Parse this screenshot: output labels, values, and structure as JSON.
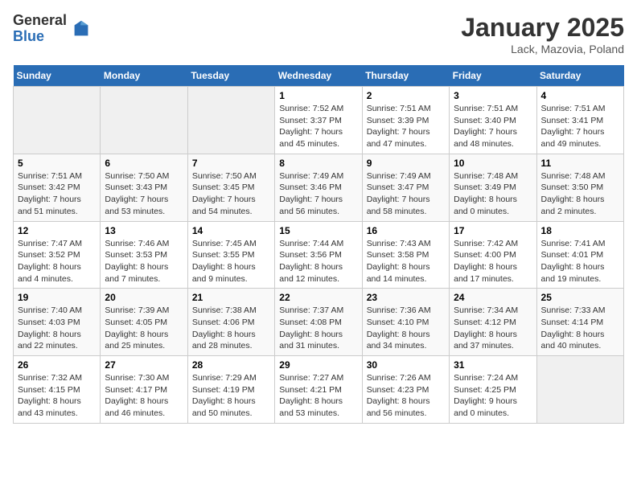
{
  "logo": {
    "general": "General",
    "blue": "Blue"
  },
  "title": "January 2025",
  "location": "Lack, Mazovia, Poland",
  "days_of_week": [
    "Sunday",
    "Monday",
    "Tuesday",
    "Wednesday",
    "Thursday",
    "Friday",
    "Saturday"
  ],
  "weeks": [
    [
      {
        "day": "",
        "info": ""
      },
      {
        "day": "",
        "info": ""
      },
      {
        "day": "",
        "info": ""
      },
      {
        "day": "1",
        "info": "Sunrise: 7:52 AM\nSunset: 3:37 PM\nDaylight: 7 hours and 45 minutes."
      },
      {
        "day": "2",
        "info": "Sunrise: 7:51 AM\nSunset: 3:39 PM\nDaylight: 7 hours and 47 minutes."
      },
      {
        "day": "3",
        "info": "Sunrise: 7:51 AM\nSunset: 3:40 PM\nDaylight: 7 hours and 48 minutes."
      },
      {
        "day": "4",
        "info": "Sunrise: 7:51 AM\nSunset: 3:41 PM\nDaylight: 7 hours and 49 minutes."
      }
    ],
    [
      {
        "day": "5",
        "info": "Sunrise: 7:51 AM\nSunset: 3:42 PM\nDaylight: 7 hours and 51 minutes."
      },
      {
        "day": "6",
        "info": "Sunrise: 7:50 AM\nSunset: 3:43 PM\nDaylight: 7 hours and 53 minutes."
      },
      {
        "day": "7",
        "info": "Sunrise: 7:50 AM\nSunset: 3:45 PM\nDaylight: 7 hours and 54 minutes."
      },
      {
        "day": "8",
        "info": "Sunrise: 7:49 AM\nSunset: 3:46 PM\nDaylight: 7 hours and 56 minutes."
      },
      {
        "day": "9",
        "info": "Sunrise: 7:49 AM\nSunset: 3:47 PM\nDaylight: 7 hours and 58 minutes."
      },
      {
        "day": "10",
        "info": "Sunrise: 7:48 AM\nSunset: 3:49 PM\nDaylight: 8 hours and 0 minutes."
      },
      {
        "day": "11",
        "info": "Sunrise: 7:48 AM\nSunset: 3:50 PM\nDaylight: 8 hours and 2 minutes."
      }
    ],
    [
      {
        "day": "12",
        "info": "Sunrise: 7:47 AM\nSunset: 3:52 PM\nDaylight: 8 hours and 4 minutes."
      },
      {
        "day": "13",
        "info": "Sunrise: 7:46 AM\nSunset: 3:53 PM\nDaylight: 8 hours and 7 minutes."
      },
      {
        "day": "14",
        "info": "Sunrise: 7:45 AM\nSunset: 3:55 PM\nDaylight: 8 hours and 9 minutes."
      },
      {
        "day": "15",
        "info": "Sunrise: 7:44 AM\nSunset: 3:56 PM\nDaylight: 8 hours and 12 minutes."
      },
      {
        "day": "16",
        "info": "Sunrise: 7:43 AM\nSunset: 3:58 PM\nDaylight: 8 hours and 14 minutes."
      },
      {
        "day": "17",
        "info": "Sunrise: 7:42 AM\nSunset: 4:00 PM\nDaylight: 8 hours and 17 minutes."
      },
      {
        "day": "18",
        "info": "Sunrise: 7:41 AM\nSunset: 4:01 PM\nDaylight: 8 hours and 19 minutes."
      }
    ],
    [
      {
        "day": "19",
        "info": "Sunrise: 7:40 AM\nSunset: 4:03 PM\nDaylight: 8 hours and 22 minutes."
      },
      {
        "day": "20",
        "info": "Sunrise: 7:39 AM\nSunset: 4:05 PM\nDaylight: 8 hours and 25 minutes."
      },
      {
        "day": "21",
        "info": "Sunrise: 7:38 AM\nSunset: 4:06 PM\nDaylight: 8 hours and 28 minutes."
      },
      {
        "day": "22",
        "info": "Sunrise: 7:37 AM\nSunset: 4:08 PM\nDaylight: 8 hours and 31 minutes."
      },
      {
        "day": "23",
        "info": "Sunrise: 7:36 AM\nSunset: 4:10 PM\nDaylight: 8 hours and 34 minutes."
      },
      {
        "day": "24",
        "info": "Sunrise: 7:34 AM\nSunset: 4:12 PM\nDaylight: 8 hours and 37 minutes."
      },
      {
        "day": "25",
        "info": "Sunrise: 7:33 AM\nSunset: 4:14 PM\nDaylight: 8 hours and 40 minutes."
      }
    ],
    [
      {
        "day": "26",
        "info": "Sunrise: 7:32 AM\nSunset: 4:15 PM\nDaylight: 8 hours and 43 minutes."
      },
      {
        "day": "27",
        "info": "Sunrise: 7:30 AM\nSunset: 4:17 PM\nDaylight: 8 hours and 46 minutes."
      },
      {
        "day": "28",
        "info": "Sunrise: 7:29 AM\nSunset: 4:19 PM\nDaylight: 8 hours and 50 minutes."
      },
      {
        "day": "29",
        "info": "Sunrise: 7:27 AM\nSunset: 4:21 PM\nDaylight: 8 hours and 53 minutes."
      },
      {
        "day": "30",
        "info": "Sunrise: 7:26 AM\nSunset: 4:23 PM\nDaylight: 8 hours and 56 minutes."
      },
      {
        "day": "31",
        "info": "Sunrise: 7:24 AM\nSunset: 4:25 PM\nDaylight: 9 hours and 0 minutes."
      },
      {
        "day": "",
        "info": ""
      }
    ]
  ]
}
